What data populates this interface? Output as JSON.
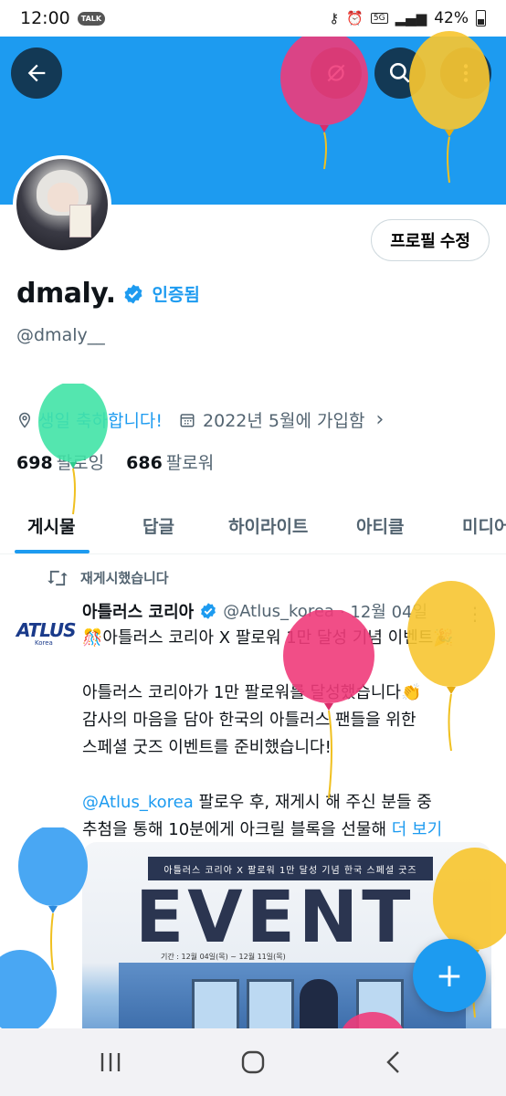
{
  "status_bar": {
    "time": "12:00",
    "talk_badge": "TALK",
    "battery": "42%",
    "network": "5G",
    "icons": [
      "key-icon",
      "alarm-icon",
      "signal-icon",
      "battery-icon"
    ]
  },
  "header": {
    "back_icon": "arrow-left-icon",
    "icons": [
      "satellite-off-icon",
      "search-icon",
      "more-vertical-icon"
    ],
    "banner_color": "#1d9bf0"
  },
  "profile": {
    "edit_button": "프로필 수정",
    "display_name": "dmaly.",
    "verified_label": "인증됨",
    "handle": "@dmaly__",
    "birthday": "생일 축하합니다!",
    "joined": "2022년 5월에 가입함",
    "following_count": "698",
    "following_label": "팔로잉",
    "followers_count": "686",
    "followers_label": "팔로워"
  },
  "tabs": [
    {
      "label": "게시물",
      "active": true
    },
    {
      "label": "답글",
      "active": false
    },
    {
      "label": "하이라이트",
      "active": false
    },
    {
      "label": "아티클",
      "active": false
    },
    {
      "label": "미디어",
      "active": false
    }
  ],
  "tweet": {
    "repost_label": "재게시했습니다",
    "author_logo": "ATLUS",
    "author_logo_sub": "Korea",
    "author_name": "아틀러스 코리아",
    "author_handle": "@Atlus_korea",
    "date": "· 12월 04일",
    "lines": [
      "🎊아틀러스 코리아 X 팔로워 1만 달성 기념 이벤트🎉",
      "아틀러스 코리아가 1만 팔로워를 달성했습니다👏",
      "감사의 마음을 담아 한국의 아틀러스 팬들을 위한",
      "스페셜 굿즈 이벤트를 준비했습니다!"
    ],
    "mention": "@Atlus_korea",
    "line5_rest": " 팔로우 후, 재게시 해 주신 분들 중",
    "line6": "추첨을 통해 10분에게 아크릴 블록을 선물해",
    "more_link": "더 보기",
    "media": {
      "strip_text": "아틀러스 코리아 X 팔로워 1만 달성 기념 한국 스페셜 굿즈",
      "title": "EVENT",
      "period": "기간 : 12월 04일(목) ~ 12월 11일(목)"
    }
  },
  "fab_label": "+",
  "colors": {
    "accent": "#1d9bf0",
    "secondary_text": "#536471",
    "balloon_pink": "#f03b7a",
    "balloon_yellow": "#f7c531",
    "balloon_green": "#41e3a6",
    "balloon_blue": "#3a9ff2"
  }
}
